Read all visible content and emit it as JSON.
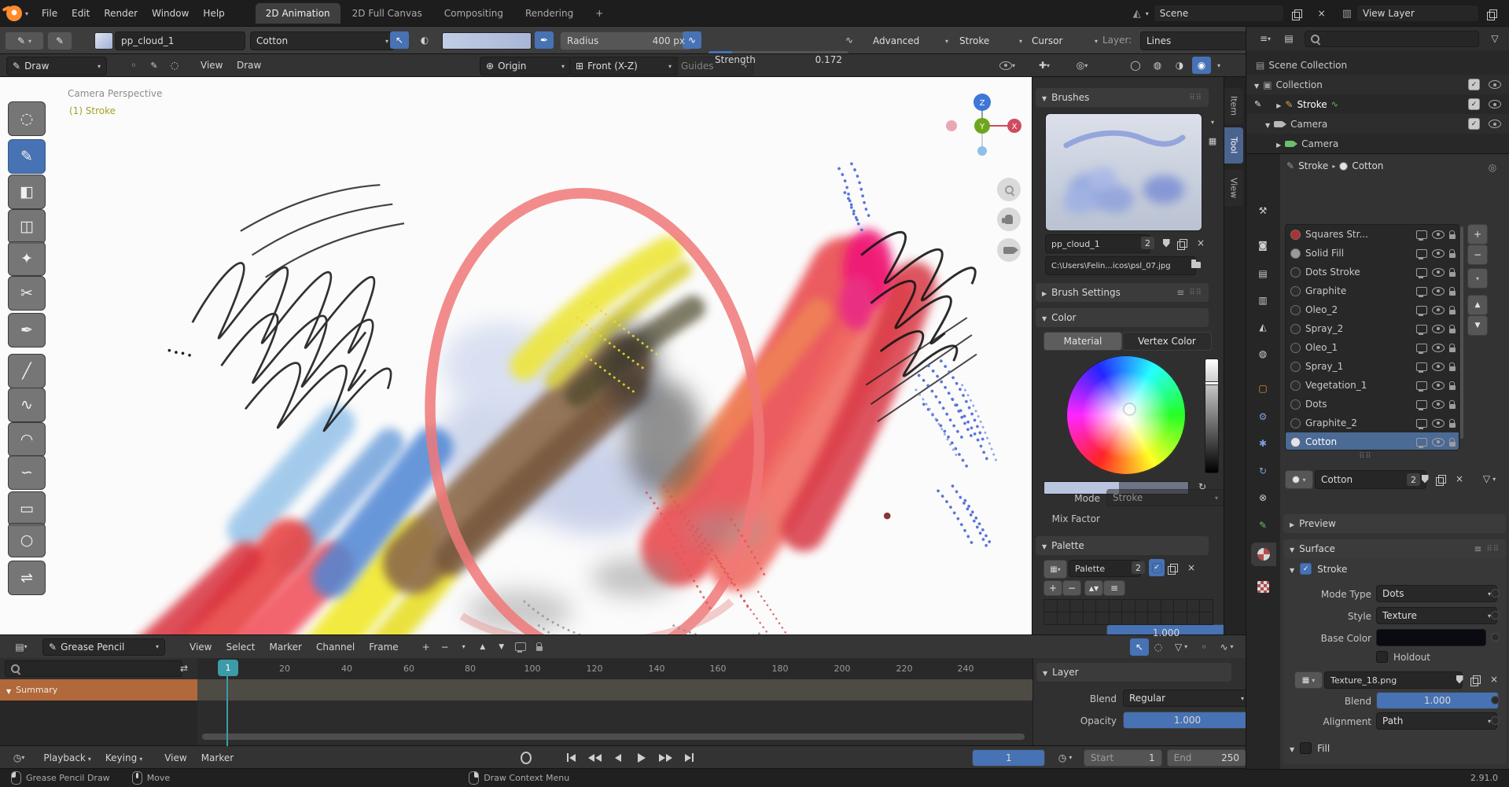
{
  "topbar": {
    "menus": [
      "File",
      "Edit",
      "Render",
      "Window",
      "Help"
    ],
    "workspaces": [
      {
        "label": "2D Animation"
      },
      {
        "label": "2D Full Canvas"
      },
      {
        "label": "Compositing"
      },
      {
        "label": "Rendering"
      }
    ],
    "add_tab": "+",
    "scene_label": "Scene",
    "view_layer_label": "View Layer"
  },
  "tool_settings": {
    "material_name": "pp_cloud_1",
    "brush_name": "Cotton",
    "radius_label": "Radius",
    "radius_value": "400 px",
    "strength_label": "Strength",
    "strength_value": "0.172",
    "advanced_label": "Advanced",
    "stroke_label": "Stroke",
    "cursor_label": "Cursor",
    "layer_label": "Layer:",
    "layer_value": "Lines"
  },
  "viewport_header": {
    "tool_label": "Draw",
    "view_menu": "View",
    "draw_menu": "Draw",
    "origin": "Origin",
    "orientation": "Front (X-Z)",
    "guides": "Guides"
  },
  "viewport": {
    "perspective_label": "Camera Perspective",
    "stroke_label": "(1) Stroke",
    "axis_x": "X",
    "axis_y": "Y",
    "axis_z": "Z"
  },
  "toolbar_tools": [
    {
      "name": "tweak",
      "glyph": "◌"
    },
    {
      "name": "draw",
      "glyph": "✎"
    },
    {
      "name": "fill",
      "glyph": "◧"
    },
    {
      "name": "erase",
      "glyph": "◫"
    },
    {
      "name": "tint",
      "glyph": "✦"
    },
    {
      "name": "cutter",
      "glyph": "✂"
    },
    {
      "name": "eyedropper",
      "glyph": "✒"
    },
    {
      "name": "line",
      "glyph": "╱"
    },
    {
      "name": "polyline",
      "glyph": "∿"
    },
    {
      "name": "arc",
      "glyph": "◠"
    },
    {
      "name": "curve",
      "glyph": "∽"
    },
    {
      "name": "box",
      "glyph": "▭"
    },
    {
      "name": "circle",
      "glyph": "○"
    },
    {
      "name": "interpolate",
      "glyph": "⇌"
    }
  ],
  "sidebar": {
    "tabs": [
      {
        "label": "Item"
      },
      {
        "label": "Tool"
      },
      {
        "label": "View"
      }
    ],
    "brushes": {
      "title": "Brushes",
      "name": "pp_cloud_1",
      "users": "2",
      "path": "C:\\Users\\Felin...icos\\psl_07.jpg"
    },
    "brush_settings_title": "Brush Settings",
    "color": {
      "title": "Color",
      "material_tab": "Material",
      "vertex_tab": "Vertex Color",
      "mode_label": "Mode",
      "mode_value": "Stroke",
      "mix_label": "Mix Factor",
      "mix_value": "1.000"
    },
    "palette": {
      "title": "Palette",
      "name": "Palette",
      "users": "2"
    }
  },
  "layer_panel": {
    "title": "Layer",
    "blend_label": "Blend",
    "blend_value": "Regular",
    "opacity_label": "Opacity",
    "opacity_value": "1.000"
  },
  "dopesheet": {
    "mode_label": "Grease Pencil",
    "menus": [
      "View",
      "Select",
      "Marker",
      "Channel",
      "Frame"
    ],
    "ruler": [
      "20",
      "40",
      "60",
      "80",
      "100",
      "120",
      "140",
      "160",
      "180",
      "200",
      "220",
      "240"
    ],
    "current_frame": "1",
    "summary_label": "Summary"
  },
  "playback": {
    "menus": [
      "Playback",
      "Keying",
      "View",
      "Marker"
    ],
    "frame_value": "1",
    "start_label": "Start",
    "start_value": "1",
    "end_label": "End",
    "end_value": "250"
  },
  "status": {
    "lmb_label": "Grease Pencil Draw",
    "mmb_label": "Move",
    "rmb_label": "Draw Context Menu",
    "version": "2.91.0"
  },
  "outliner": {
    "scene_collection": "Scene Collection",
    "collection": "Collection",
    "stroke": "Stroke",
    "camera": "Camera",
    "camera_data": "Camera"
  },
  "properties": {
    "breadcrumb": {
      "object": "Stroke",
      "material": "Cotton"
    },
    "slots": [
      {
        "name": "Squares Str...",
        "color": "#b03030"
      },
      {
        "name": "Solid Fill",
        "color": "#9a9a9a"
      },
      {
        "name": "Dots Stroke",
        "color": "#2d2d2d"
      },
      {
        "name": "Graphite",
        "color": "#2d2d2d"
      },
      {
        "name": "Oleo_2",
        "color": "#2d2d2d"
      },
      {
        "name": "Spray_2",
        "color": "#2d2d2d"
      },
      {
        "name": "Oleo_1",
        "color": "#2d2d2d"
      },
      {
        "name": "Spray_1",
        "color": "#2d2d2d"
      },
      {
        "name": "Vegetation_1",
        "color": "#2d2d2d"
      },
      {
        "name": "Dots",
        "color": "#2d2d2d"
      },
      {
        "name": "Graphite_2",
        "color": "#2d2d2d"
      },
      {
        "name": "Cotton",
        "color": "#e2e2ec"
      }
    ],
    "active_name": "Cotton",
    "users": "2",
    "preview_title": "Preview",
    "surface_title": "Surface",
    "stroke_section": "Stroke",
    "rows": {
      "mode_type_label": "Mode Type",
      "mode_type": "Dots",
      "style_label": "Style",
      "style": "Texture",
      "base_color_label": "Base Color",
      "holdout_label": "Holdout",
      "texture_name": "Texture_18.png",
      "blend_label": "Blend",
      "blend": "1.000",
      "alignment_label": "Alignment",
      "alignment": "Path"
    },
    "fill_section": "Fill"
  },
  "prop_tabs": [
    {
      "name": "tool",
      "glyph": "⚒"
    },
    {
      "name": "render",
      "glyph": "◙"
    },
    {
      "name": "output",
      "glyph": "▤"
    },
    {
      "name": "view-layer",
      "glyph": "▥"
    },
    {
      "name": "scene",
      "glyph": "◭"
    },
    {
      "name": "world",
      "glyph": "◍"
    },
    {
      "name": "object",
      "glyph": "▢"
    },
    {
      "name": "modifiers",
      "glyph": "⚙"
    },
    {
      "name": "particles",
      "glyph": "✱"
    },
    {
      "name": "physics",
      "glyph": "↻"
    },
    {
      "name": "constraints",
      "glyph": "⊗"
    },
    {
      "name": "object-data",
      "glyph": "✎"
    }
  ],
  "glyphs": {
    "pencil": "✎",
    "halfcircle": "◐",
    "pressure": "∿",
    "eyedrop": "✒",
    "origin": "⊕",
    "grid": "⊞",
    "gizmo": "✚",
    "overlay": "◎",
    "refresh": "↻",
    "funnel": "▽",
    "clock": "◷",
    "swap": "⇄",
    "cursor_arrow": "↖",
    "menu": "≡",
    "gripdots": "⠿⠿",
    "plus": "+",
    "minus": "−",
    "close": "×",
    "up": "▲",
    "down": "▼",
    "editor_dope": "▤",
    "editor_outliner": "≡",
    "collection": "▣",
    "scene_col": "▤",
    "image": "▦",
    "ghost": "◌",
    "dot": "◦",
    "pin": "◎",
    "shading": [
      "◯",
      "◍",
      "◑",
      "◉"
    ]
  },
  "colors": {
    "accent": "#4772b3",
    "playhead": "#3d9aa8",
    "summary_channel": "#b1683a",
    "brush_color": "#b9c4de",
    "selected_slot": "#4b6a94"
  }
}
